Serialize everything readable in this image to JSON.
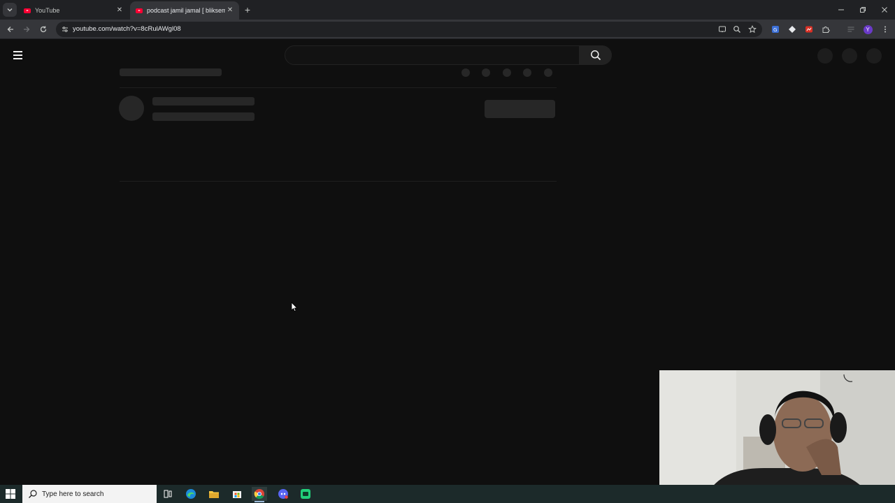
{
  "browser": {
    "tabs": [
      {
        "title": "YouTube",
        "active": false
      },
      {
        "title": "podcast jamil jamal [ bliksem] ...",
        "active": true
      }
    ],
    "address_url": "youtube.com/watch?v=8cRulAWgl08",
    "window_controls": [
      "minimize",
      "restore",
      "close"
    ],
    "profile_initial": "Y"
  },
  "youtube": {
    "search_placeholder": "",
    "state": "loading-skeleton"
  },
  "taskbar": {
    "search_placeholder": "Type here to search",
    "apps": [
      "task-view",
      "edge",
      "file-explorer",
      "microsoft-store",
      "chrome",
      "discord",
      "other-app"
    ]
  },
  "colors": {
    "page_bg": "#0f0f0f",
    "skeleton": "#272727",
    "browser_dark": "#202124",
    "toolbar": "#35363a",
    "youtube_red": "#ff0033"
  }
}
